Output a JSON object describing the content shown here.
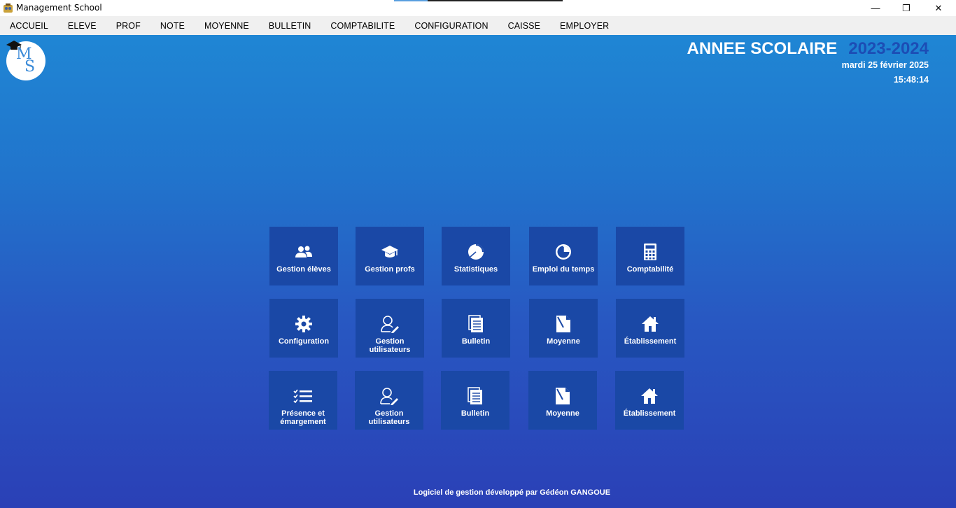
{
  "window": {
    "title": "Management School",
    "minimize": "—",
    "maximize": "❐",
    "close": "✕"
  },
  "menu": [
    {
      "label": "ACCUEIL"
    },
    {
      "label": "ELEVE"
    },
    {
      "label": "PROF"
    },
    {
      "label": "NOTE"
    },
    {
      "label": "MOYENNE"
    },
    {
      "label": "BULLETIN"
    },
    {
      "label": "COMPTABILITE"
    },
    {
      "label": "CONFIGURATION"
    },
    {
      "label": "CAISSE"
    },
    {
      "label": "EMPLOYER"
    }
  ],
  "logo": {
    "letter1": "M",
    "letter2": "S"
  },
  "header": {
    "year_label": "ANNEE SCOLAIRE",
    "year_value": "2023-2024",
    "date": "mardi 25 février 2025",
    "time": "15:48:14"
  },
  "tiles": [
    {
      "label": "Gestion élèves",
      "icon": "users-icon"
    },
    {
      "label": "Gestion profs",
      "icon": "graduation-cap-icon"
    },
    {
      "label": "Statistiques",
      "icon": "pie-chart-icon"
    },
    {
      "label": "Emploi du temps",
      "icon": "clock-icon"
    },
    {
      "label": "Comptabilité",
      "icon": "calculator-icon"
    },
    {
      "label": "Configuration",
      "icon": "gear-icon"
    },
    {
      "label": "Gestion utilisateurs",
      "icon": "user-edit-icon"
    },
    {
      "label": "Bulletin",
      "icon": "document-icon"
    },
    {
      "label": "Moyenne",
      "icon": "note-icon"
    },
    {
      "label": "Établissement",
      "icon": "home-icon"
    },
    {
      "label": "Présence et émargement",
      "icon": "checklist-icon"
    },
    {
      "label": "Gestion utilisateurs",
      "icon": "user-edit-icon"
    },
    {
      "label": "Bulletin",
      "icon": "document-icon"
    },
    {
      "label": "Moyenne",
      "icon": "note-icon"
    },
    {
      "label": "Établissement",
      "icon": "home-icon"
    }
  ],
  "footer": {
    "text": "Logiciel de gestion développé par Gédéon GANGOUE"
  }
}
